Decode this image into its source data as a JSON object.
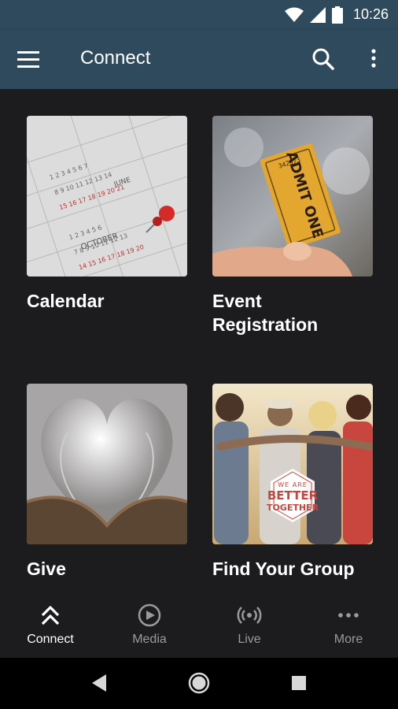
{
  "status_bar": {
    "time": "10:26",
    "icons": [
      "wifi-icon",
      "signal-icon",
      "battery-icon"
    ]
  },
  "app_bar": {
    "title": "Connect",
    "icons": [
      "menu-icon",
      "search-icon",
      "more-vert-icon"
    ]
  },
  "tiles": [
    {
      "label": "Calendar",
      "image": "calendar-photo"
    },
    {
      "label": "Event\nRegistration",
      "image": "admit-one-ticket-photo"
    },
    {
      "label": "Give",
      "image": "book-heart-photo"
    },
    {
      "label": "Find Your Group",
      "image": "group-photo",
      "badge": {
        "line1": "WE ARE",
        "line2": "BETTER",
        "line3": "TOGETHER"
      }
    }
  ],
  "calendar_photo": {
    "month1": "JUNE",
    "month2": "OCTOBER"
  },
  "ticket_photo": {
    "text": "ADMIT ONE",
    "serial": "342573"
  },
  "bottom_nav": [
    {
      "label": "Connect",
      "icon": "chevrons-up-icon",
      "active": true
    },
    {
      "label": "Media",
      "icon": "play-circle-icon",
      "active": false
    },
    {
      "label": "Live",
      "icon": "broadcast-icon",
      "active": false
    },
    {
      "label": "More",
      "icon": "more-horiz-icon",
      "active": false
    }
  ],
  "colors": {
    "app_bar": "#2e4a5c",
    "background": "#1c1c1e",
    "active": "#ffffff",
    "inactive": "#9a9a9a"
  }
}
